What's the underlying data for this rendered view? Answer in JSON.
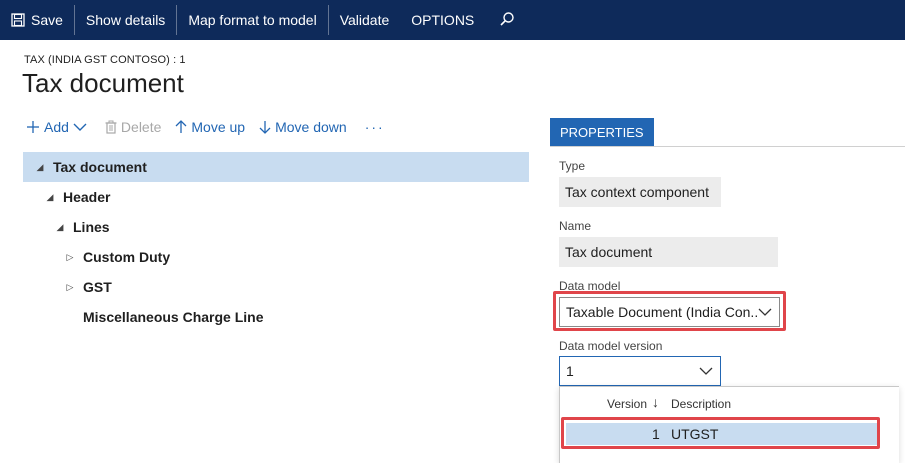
{
  "toolbar": {
    "save_label": "Save",
    "show_details_label": "Show details",
    "map_format_label": "Map format to model",
    "validate_label": "Validate",
    "options_label": "OPTIONS",
    "search_icon": "search-icon",
    "save_icon": "floppy-disk-icon"
  },
  "header": {
    "breadcrumb": "TAX (INDIA GST CONTOSO) : 1",
    "title": "Tax document"
  },
  "tree_toolbar": {
    "add_label": "Add",
    "delete_label": "Delete",
    "move_up_label": "Move up",
    "move_down_label": "Move down",
    "more_label": "···"
  },
  "tree": {
    "nodes": [
      {
        "label": "Tax document",
        "level": 0,
        "expanded": true,
        "selected": true
      },
      {
        "label": "Header",
        "level": 1,
        "expanded": true
      },
      {
        "label": "Lines",
        "level": 2,
        "expanded": true
      },
      {
        "label": "Custom Duty",
        "level": 3,
        "expanded": false
      },
      {
        "label": "GST",
        "level": 3,
        "expanded": false
      },
      {
        "label": "Miscellaneous Charge Line",
        "level": 3,
        "leaf": true
      }
    ]
  },
  "properties": {
    "tab_label": "PROPERTIES",
    "type_label": "Type",
    "type_value": "Tax context component",
    "name_label": "Name",
    "name_value": "Tax document",
    "data_model_label": "Data model",
    "data_model_value": "Taxable Document (India Con...",
    "data_model_version_label": "Data model version",
    "data_model_version_value": "1",
    "dropdown": {
      "col_version": "Version",
      "col_description": "Description",
      "rows": [
        {
          "version": "1",
          "description": "UTGST"
        }
      ]
    }
  },
  "colors": {
    "topbar": "#0e2a5a",
    "accent": "#2266b3",
    "selection": "#c8dcf0",
    "highlight": "#e0454a"
  }
}
